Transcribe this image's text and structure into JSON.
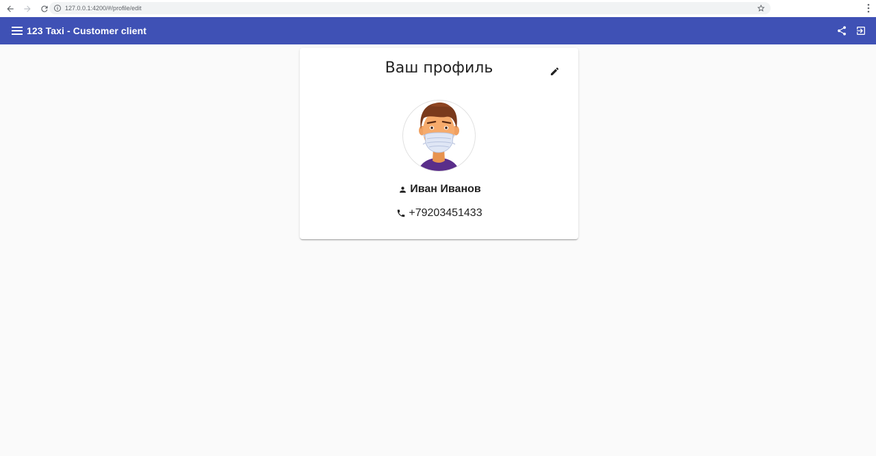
{
  "browser": {
    "url": "127.0.0.1:4200/#/profile/edit"
  },
  "toolbar": {
    "title": "123 Taxi - Customer client",
    "background_color": "#3f51b5",
    "icons": [
      "menu-icon",
      "share-icon",
      "logout-icon"
    ]
  },
  "profile": {
    "heading": "Ваш профиль",
    "name": "Иван Иванов",
    "phone": "+79203451433",
    "icons": [
      "edit-icon",
      "person-icon",
      "phone-icon"
    ]
  }
}
